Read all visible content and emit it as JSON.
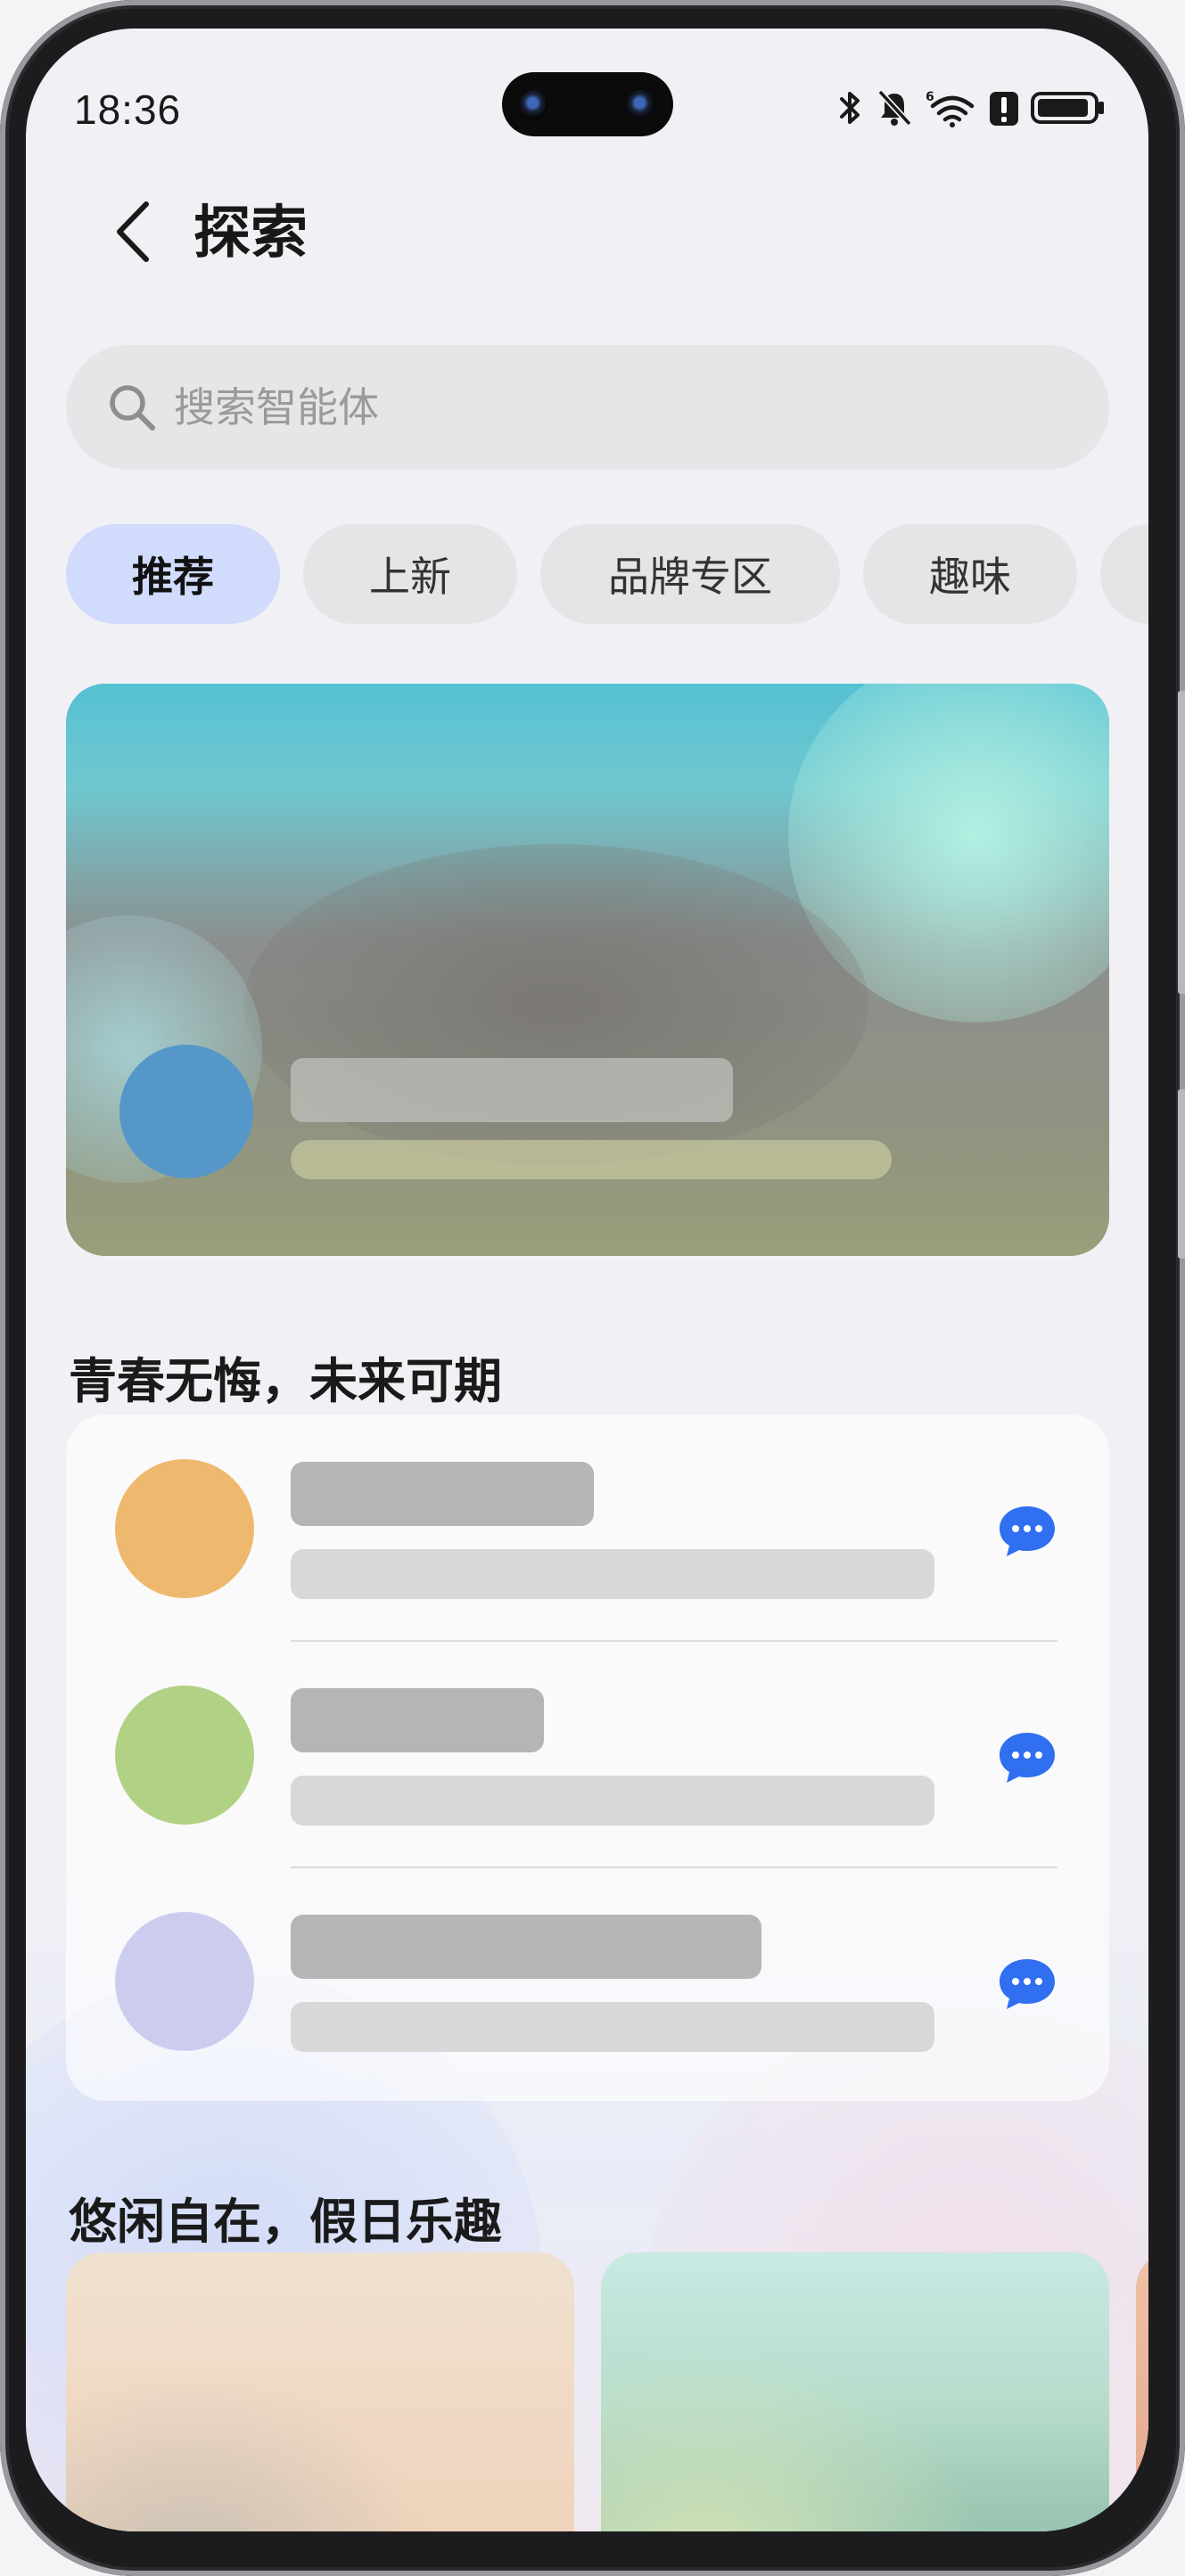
{
  "status_bar": {
    "time": "18:36",
    "icons": [
      "bluetooth-icon",
      "mute-bell-icon",
      "wifi-6-icon",
      "alert-icon",
      "battery-icon"
    ]
  },
  "header": {
    "title": "探索",
    "back_icon": "chevron-left-icon"
  },
  "search": {
    "placeholder": "搜索智能体",
    "icon": "search-icon"
  },
  "tabs": [
    {
      "label": "推荐",
      "active": true
    },
    {
      "label": "上新",
      "active": false
    },
    {
      "label": "品牌专区",
      "active": false
    },
    {
      "label": "趣味",
      "active": false
    }
  ],
  "sections": {
    "youth": {
      "title": "青春无悔，未来可期",
      "items": [
        {
          "avatar_color": "#eeb86e",
          "chat_icon": "chat-bubble-icon"
        },
        {
          "avatar_color": "#b1d184",
          "chat_icon": "chat-bubble-icon"
        },
        {
          "avatar_color": "#cccdee",
          "chat_icon": "chat-bubble-icon"
        }
      ]
    },
    "leisure": {
      "title": "悠闲自在，假日乐趣"
    }
  },
  "colors": {
    "accent_blue": "#2f6ff0",
    "active_tab_bg": "#d1dbfb",
    "banner_avatar": "#5597c9"
  }
}
